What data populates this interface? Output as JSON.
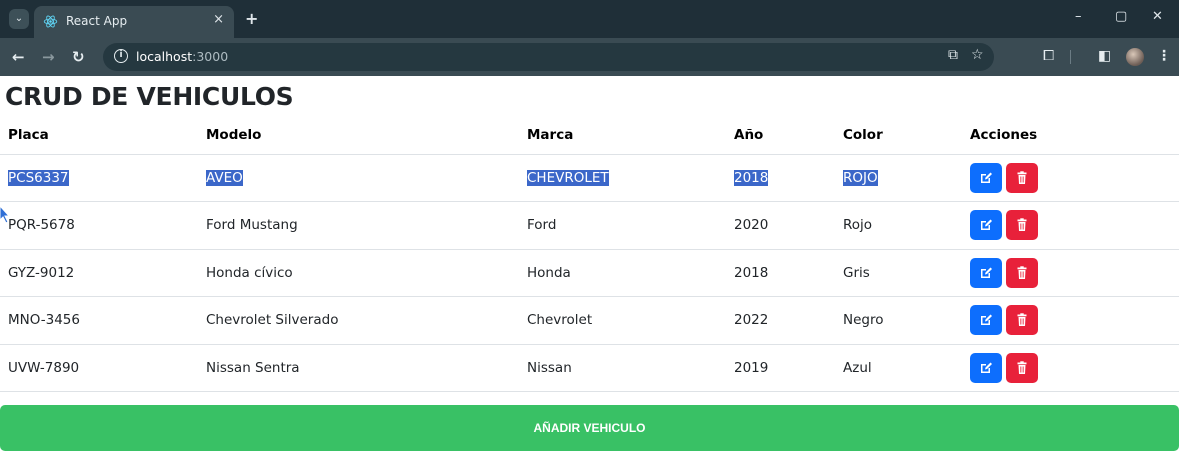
{
  "browser": {
    "tab_title": "React App",
    "tab_close": "×",
    "new_tab": "+",
    "url_host": "localhost",
    "url_port": ":3000",
    "window_controls": [
      "–",
      "▢",
      "✕"
    ]
  },
  "app": {
    "title": "CRUD DE VEHICULOS",
    "columns": [
      "Placa",
      "Modelo",
      "Marca",
      "Año",
      "Color",
      "Acciones"
    ],
    "rows": [
      {
        "placa": "PCS6337",
        "modelo": "AVEO",
        "marca": "CHEVROLET",
        "anio": "2018",
        "color": "ROJO",
        "selected": true
      },
      {
        "placa": "PQR-5678",
        "modelo": "Ford Mustang",
        "marca": "Ford",
        "anio": "2020",
        "color": "Rojo",
        "selected": false
      },
      {
        "placa": "GYZ-9012",
        "modelo": "Honda cívico",
        "marca": "Honda",
        "anio": "2018",
        "color": "Gris",
        "selected": false
      },
      {
        "placa": "MNO-3456",
        "modelo": "Chevrolet Silverado",
        "marca": "Chevrolet",
        "anio": "2022",
        "color": "Negro",
        "selected": false
      },
      {
        "placa": "UVW-7890",
        "modelo": "Nissan Sentra",
        "marca": "Nissan",
        "anio": "2019",
        "color": "Azul",
        "selected": false
      }
    ],
    "add_button_label": "AÑADIR VEHICULO"
  },
  "colors": {
    "edit": "#0d6efd",
    "delete": "#e8213a",
    "add": "#39c165",
    "selection": "#3b67c9"
  },
  "icons": {
    "edit": "edit-icon",
    "delete": "trash-icon"
  }
}
